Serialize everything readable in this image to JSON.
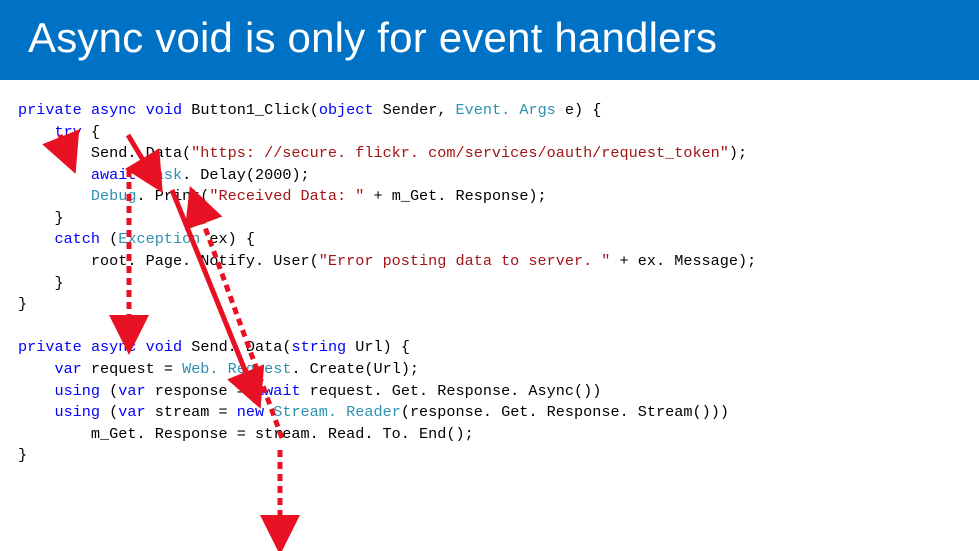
{
  "slide": {
    "title": "Async void is only for event handlers",
    "code1": {
      "l1_a": "private",
      "l1_b": "async",
      "l1_c": "void",
      "l1_d": " Button1_Click(",
      "l1_e": "object",
      "l1_f": " Sender, ",
      "l1_g": "Event. Args",
      "l1_h": " e) {",
      "l2_a": "    try",
      "l2_b": " {",
      "l3_a": "        Send. Data(",
      "l3_b": "\"https: //secure. flickr. com/services/oauth/request_token\"",
      "l3_c": ");",
      "l4_a": "        await",
      "l4_b": " ",
      "l4_c": "Task",
      "l4_d": ". Delay(2000);",
      "l5_a": "        ",
      "l5_b": "Debug",
      "l5_c": ". Print(",
      "l5_d": "\"Received Data: \"",
      "l5_e": " + m_Get. Response);",
      "l6": "    }",
      "l7_a": "    catch",
      "l7_b": " (",
      "l7_c": "Exception",
      "l7_d": " ex) {",
      "l8_a": "        root. Page. Notify. User(",
      "l8_b": "\"Error posting data to server. \"",
      "l8_c": " + ex. Message);",
      "l9": "    }",
      "l10": "}"
    },
    "code2": {
      "l1_a": "private",
      "l1_b": "async",
      "l1_c": "void",
      "l1_d": " Send. Data(",
      "l1_e": "string",
      "l1_f": " Url) {",
      "l2_a": "    var",
      "l2_b": " request = ",
      "l2_c": "Web. Request",
      "l2_d": ". Create(Url);",
      "l3_a": "    using",
      "l3_b": " (",
      "l3_c": "var",
      "l3_d": " response = ",
      "l3_e": "await",
      "l3_f": " request. Get. Response. Async())",
      "l4_a": "    using",
      "l4_b": " (",
      "l4_c": "var",
      "l4_d": " stream = ",
      "l4_e": "new",
      "l4_f": " ",
      "l4_g": "Stream. Reader",
      "l4_h": "(response. Get. Response. Stream()))",
      "l5": "        m_Get. Response = stream. Read. To. End();",
      "l6": "}"
    }
  }
}
